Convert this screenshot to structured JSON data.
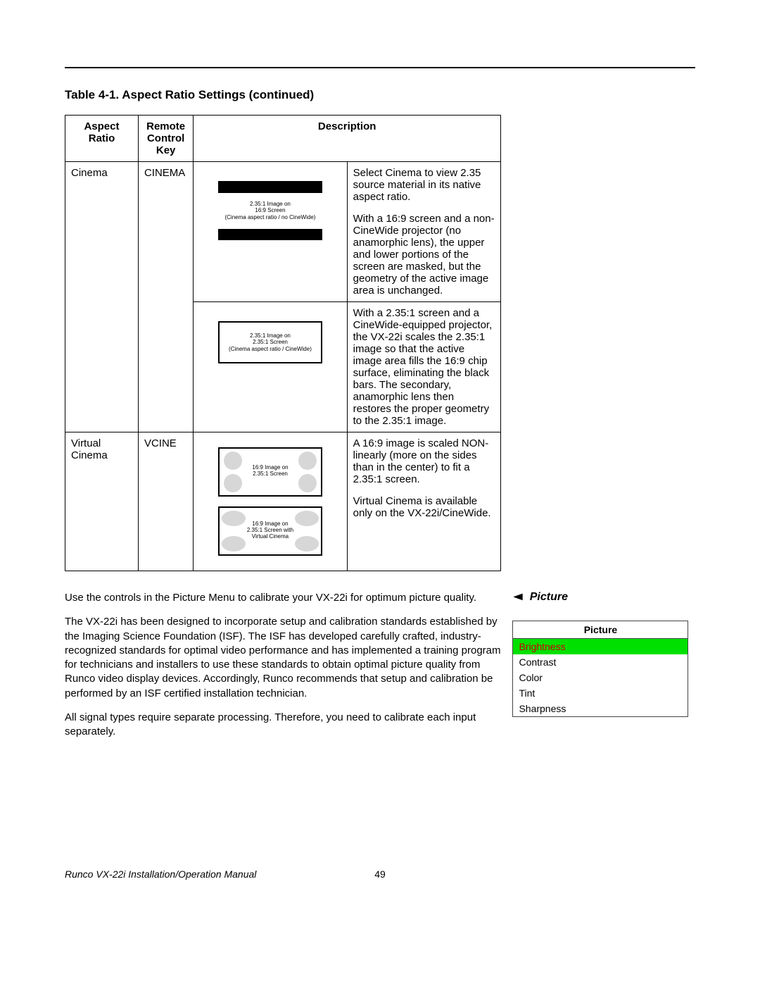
{
  "table_title": "Table 4-1. Aspect Ratio Settings (continued)",
  "headers": {
    "ar": "Aspect Ratio",
    "rc": "Remote Control Key",
    "desc": "Description"
  },
  "rows": {
    "cinema": {
      "ar": "Cinema",
      "rc": "CINEMA",
      "diag1_line1": "2.35:1 Image on",
      "diag1_line2": "16:9 Screen",
      "diag1_line3": "(Cinema aspect ratio / no CineWide)",
      "desc1": "Select Cinema to view 2.35 source material in its native aspect ratio.",
      "desc2": "With a 16:9 screen and a non-CineWide projector (no anamorphic lens), the upper and lower portions of the screen are masked, but the geometry of the active image area is unchanged.",
      "diag2_line1": "2.35:1 Image on",
      "diag2_line2": "2.35:1 Screen",
      "diag2_line3": "(Cinema aspect ratio / CineWide)",
      "desc3": "With a 2.35:1 screen and a CineWide-equipped projector, the VX-22i scales the 2.35:1 image so that the active image area fills the 16:9 chip surface, eliminating the black bars. The secondary, anamorphic lens then restores the proper geometry to the 2.35:1 image."
    },
    "vcinema": {
      "ar": "Virtual Cinema",
      "rc": "VCINE",
      "diag1_line1": "16:9 Image on",
      "diag1_line2": "2.35:1 Screen",
      "diag2_line1": "16:9 Image on",
      "diag2_line2": "2.35:1 Screen with",
      "diag2_line3": "Virtual Cinema",
      "desc1": "A 16:9 image is scaled NON-linearly (more on the sides than in the center) to fit a 2.35:1 screen.",
      "desc2": "Virtual Cinema is available only on the VX-22i/CineWide."
    }
  },
  "body": {
    "p1": "Use the controls in the Picture Menu to calibrate your VX-22i for optimum picture quality.",
    "p2": "The VX-22i has been designed to incorporate setup and calibration standards established by the Imaging Science Foundation (ISF). The ISF has developed carefully crafted, industry-recognized standards for optimal video performance and has implemented a training program for technicians and installers to use these standards to obtain optimal picture quality from Runco video display devices. Accordingly, Runco recommends that setup and calibration be performed by an ISF certified installation technician.",
    "p3": "All signal types require separate processing. Therefore, you need to calibrate each input separately."
  },
  "side": {
    "heading": "Picture",
    "menu_title": "Picture",
    "items": {
      "brightness": "Brightness",
      "contrast": "Contrast",
      "color": "Color",
      "tint": "Tint",
      "sharpness": "Sharpness"
    }
  },
  "footer": {
    "title": "Runco VX-22i Installation/Operation Manual",
    "page": "49"
  }
}
